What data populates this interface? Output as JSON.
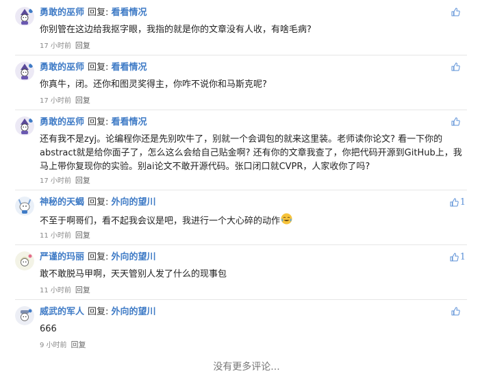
{
  "comments": [
    {
      "author": "勇敢的巫师",
      "reply_word": "回复:",
      "target": "看看情况",
      "text": "你别管在这边给我抠字眼，我指的就是你的文章没有人收，有啥毛病?",
      "time": "17 小时前",
      "reply_label": "回复",
      "likes": "",
      "avatar_icon": "wizard-avatar"
    },
    {
      "author": "勇敢的巫师",
      "reply_word": "回复:",
      "target": "看看情况",
      "text": "你真牛，闭。还你和图灵奖得主，你咋不说你和马斯克呢?",
      "time": "17 小时前",
      "reply_label": "回复",
      "likes": "",
      "avatar_icon": "wizard-avatar"
    },
    {
      "author": "勇敢的巫师",
      "reply_word": "回复:",
      "target": "看看情况",
      "text_lines": [
        "还有我不是zyj。论编程你还是先别吹牛了，别就一个会调包的就来这里装。老师读你论文? 看一下你的",
        "abstract就是给你面子了，怎么这么会给自己贴金啊? 还有你的文章我查了，你把代码开源到GitHub上，我",
        "马上带你复现你的实验。别ai论文不敢开源代码。张口闭口就CVPR，人家收你了吗?"
      ],
      "time": "17 小时前",
      "reply_label": "回复",
      "likes": "",
      "avatar_icon": "wizard-avatar"
    },
    {
      "author": "神秘的天蝎",
      "reply_word": "回复:",
      "target": "外向的望川",
      "text": "不至于啊哥们，看不起我会议是吧，我进行一个大心碎的动作",
      "time": "11 小时前",
      "reply_label": "回复",
      "likes": "1",
      "avatar_icon": "scorpion-avatar"
    },
    {
      "author": "严谨的玛丽",
      "reply_word": "回复:",
      "target": "外向的望川",
      "text": "敢不敢脱马甲啊，天天管别人发了什么的现事包",
      "time": "11 小时前",
      "reply_label": "回复",
      "likes": "1",
      "avatar_icon": "mary-avatar"
    },
    {
      "author": "威武的军人",
      "reply_word": "回复:",
      "target": "外向的望川",
      "text": "666",
      "time": "9 小时前",
      "reply_label": "回复",
      "likes": "",
      "avatar_icon": "soldier-avatar"
    }
  ],
  "footer": "没有更多评论...",
  "colors": {
    "name": "#3f7bc6",
    "like": "#5a8fd6",
    "meta": "#888888"
  }
}
